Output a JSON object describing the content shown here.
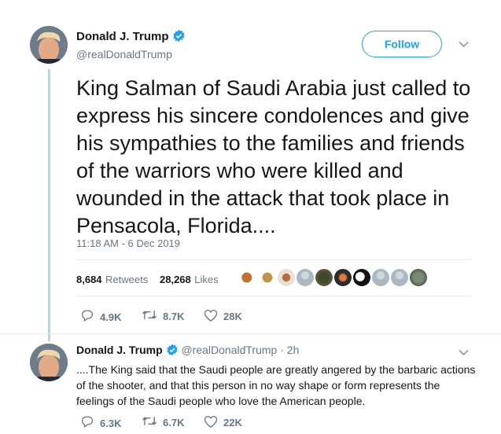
{
  "tweet": {
    "author_name": "Donald J. Trump",
    "author_handle": "@realDonaldTrump",
    "follow_label": "Follow",
    "text": "King Salman of Saudi Arabia just called to express his sincere condolences and give his sympathies to the families and friends of the warriors who were killed and wounded in the attack that took place in Pensacola, Florida....",
    "timestamp": "11:18 AM - 6 Dec 2019",
    "retweets_count": "8,684",
    "retweets_label": "Retweets",
    "likes_count": "28,268",
    "likes_label": "Likes",
    "actions": {
      "replies": "4.9K",
      "retweets": "8.7K",
      "likes": "28K"
    }
  },
  "reply": {
    "author_name": "Donald J. Trump",
    "author_handle": "@realDonaldTrump",
    "separator": "·",
    "time": "2h",
    "text": "....The King said that the Saudi people are greatly angered by the barbaric actions of the shooter, and that this person in no way shape or form represents the feelings of the Saudi people who love the American people.",
    "actions": {
      "replies": "6.3K",
      "retweets": "6.7K",
      "likes": "22K"
    }
  },
  "icons": {
    "verified": "verified-badge-icon",
    "caret": "chevron-down-icon",
    "reply": "reply-icon",
    "retweet": "retweet-icon",
    "like": "heart-icon"
  },
  "colors": {
    "accent": "#1da1f2",
    "secondary_text": "#657786",
    "thread_line": "#a6d8f7"
  }
}
